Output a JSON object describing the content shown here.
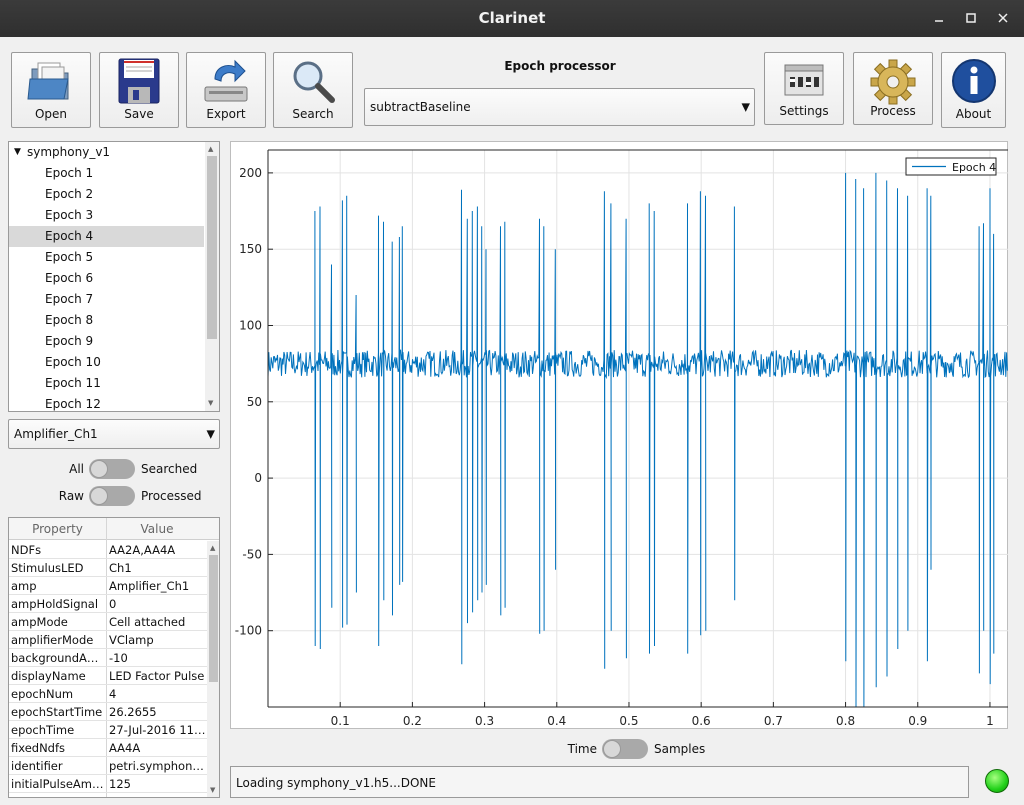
{
  "window": {
    "title": "Clarinet"
  },
  "toolbar": {
    "open_label": "Open",
    "save_label": "Save",
    "export_label": "Export",
    "search_label": "Search",
    "settings_label": "Settings",
    "process_label": "Process",
    "about_label": "About"
  },
  "processor": {
    "label": "Epoch processor",
    "selected": "subtractBaseline"
  },
  "tree": {
    "root": "symphony_v1",
    "items": [
      "Epoch 1",
      "Epoch 2",
      "Epoch 3",
      "Epoch 4",
      "Epoch 5",
      "Epoch 6",
      "Epoch 7",
      "Epoch 8",
      "Epoch 9",
      "Epoch 10",
      "Epoch 11",
      "Epoch 12"
    ],
    "selected_index": 3
  },
  "channel": {
    "selected": "Amplifier_Ch1"
  },
  "toggles": {
    "filter_left": "All",
    "filter_right": "Searched",
    "mode_left": "Raw",
    "mode_right": "Processed",
    "axis_left": "Time",
    "axis_right": "Samples"
  },
  "properties": {
    "col_property": "Property",
    "col_value": "Value",
    "rows": [
      {
        "k": "NDFs",
        "v": "AA2A,AA4A"
      },
      {
        "k": "StimulusLED",
        "v": "Ch1"
      },
      {
        "k": "amp",
        "v": "Amplifier_Ch1"
      },
      {
        "k": "ampHoldSignal",
        "v": "0"
      },
      {
        "k": "ampMode",
        "v": "Cell attached"
      },
      {
        "k": "amplifierMode",
        "v": "VClamp"
      },
      {
        "k": "backgroundAm...",
        "v": "-10"
      },
      {
        "k": "displayName",
        "v": "LED Factor Pulse"
      },
      {
        "k": "epochNum",
        "v": "4"
      },
      {
        "k": "epochStartTime",
        "v": "26.2655"
      },
      {
        "k": "epochTime",
        "v": "27-Jul-2016 11:..."
      },
      {
        "k": "fixedNdfs",
        "v": "AA4A"
      },
      {
        "k": "identifier",
        "v": "petri.symphony-..."
      },
      {
        "k": "initialPulseAmp...",
        "v": "125"
      }
    ]
  },
  "status": {
    "text": "Loading symphony_v1.h5...DONE",
    "led_color": "#22d11a"
  },
  "chart_data": {
    "type": "line",
    "legend": "Epoch 4",
    "legend_placement": "top-right",
    "color": "#0072bd",
    "xlim": [
      0,
      1.025
    ],
    "ylim": [
      -150,
      215
    ],
    "xticks": [
      0.1,
      0.2,
      0.3,
      0.4,
      0.5,
      0.6,
      0.7,
      0.8,
      0.9,
      1
    ],
    "yticks": [
      -100,
      -50,
      0,
      50,
      100,
      150,
      200
    ],
    "grid": true,
    "baseline": 75,
    "noise_amplitude": 9,
    "spikes": [
      {
        "x": 0.065,
        "max": 175,
        "min": -110
      },
      {
        "x": 0.072,
        "max": 178,
        "min": -112
      },
      {
        "x": 0.088,
        "max": 140,
        "min": -85
      },
      {
        "x": 0.103,
        "max": 182,
        "min": -98
      },
      {
        "x": 0.109,
        "max": 185,
        "min": -96
      },
      {
        "x": 0.122,
        "max": 120,
        "min": -75
      },
      {
        "x": 0.153,
        "max": 172,
        "min": -110
      },
      {
        "x": 0.16,
        "max": 168,
        "min": -80
      },
      {
        "x": 0.172,
        "max": 155,
        "min": -90
      },
      {
        "x": 0.182,
        "max": 158,
        "min": -70
      },
      {
        "x": 0.186,
        "max": 165,
        "min": -68
      },
      {
        "x": 0.268,
        "max": 189,
        "min": -122
      },
      {
        "x": 0.276,
        "max": 170,
        "min": -95
      },
      {
        "x": 0.283,
        "max": 175,
        "min": -88
      },
      {
        "x": 0.29,
        "max": 178,
        "min": -80
      },
      {
        "x": 0.296,
        "max": 165,
        "min": -75
      },
      {
        "x": 0.302,
        "max": 150,
        "min": -70
      },
      {
        "x": 0.322,
        "max": 165,
        "min": -90
      },
      {
        "x": 0.328,
        "max": 168,
        "min": -85
      },
      {
        "x": 0.376,
        "max": 170,
        "min": -102
      },
      {
        "x": 0.382,
        "max": 165,
        "min": -100
      },
      {
        "x": 0.398,
        "max": 150,
        "min": -60
      },
      {
        "x": 0.466,
        "max": 188,
        "min": -125
      },
      {
        "x": 0.475,
        "max": 180,
        "min": -100
      },
      {
        "x": 0.496,
        "max": 170,
        "min": -118
      },
      {
        "x": 0.528,
        "max": 180,
        "min": -115
      },
      {
        "x": 0.535,
        "max": 175,
        "min": -110
      },
      {
        "x": 0.581,
        "max": 180,
        "min": -115
      },
      {
        "x": 0.599,
        "max": 188,
        "min": -103
      },
      {
        "x": 0.606,
        "max": 185,
        "min": -100
      },
      {
        "x": 0.646,
        "max": 178,
        "min": -80
      },
      {
        "x": 0.8,
        "max": 200,
        "min": -120
      },
      {
        "x": 0.814,
        "max": 196,
        "min": -150
      },
      {
        "x": 0.825,
        "max": 190,
        "min": -150
      },
      {
        "x": 0.842,
        "max": 200,
        "min": -137
      },
      {
        "x": 0.857,
        "max": 195,
        "min": -130
      },
      {
        "x": 0.872,
        "max": 190,
        "min": -112
      },
      {
        "x": 0.886,
        "max": 185,
        "min": -100
      },
      {
        "x": 0.913,
        "max": 190,
        "min": -120
      },
      {
        "x": 0.918,
        "max": 185,
        "min": -60
      },
      {
        "x": 0.985,
        "max": 165,
        "min": -128
      },
      {
        "x": 0.991,
        "max": 167,
        "min": -100
      },
      {
        "x": 1.0,
        "max": 190,
        "min": -135
      },
      {
        "x": 1.005,
        "max": 160,
        "min": -115
      }
    ]
  }
}
